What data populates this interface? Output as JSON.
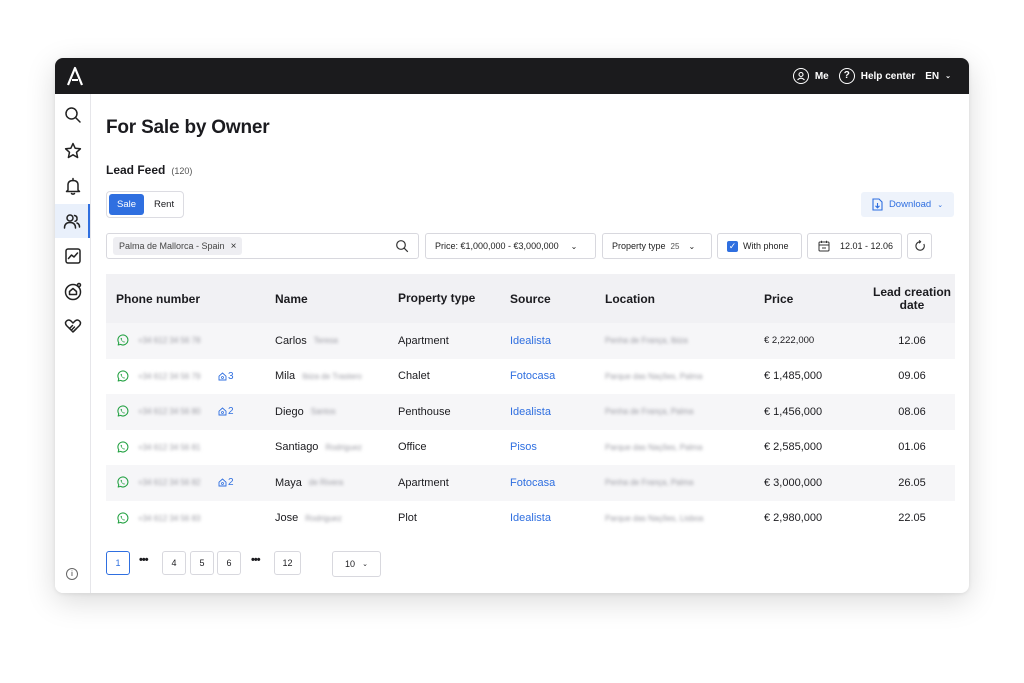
{
  "topbar": {
    "me_label": "Me",
    "help_label": "Help center",
    "lang_label": "EN",
    "help_icon_glyph": "?"
  },
  "sidebar": {
    "items": [
      "search",
      "favorites",
      "notifications",
      "leads",
      "analytics",
      "home-valuation",
      "partners"
    ],
    "active": "leads",
    "info_glyph": "i"
  },
  "page": {
    "title": "For Sale by Owner",
    "feed_title": "Lead Feed",
    "feed_count": "(120)"
  },
  "toggle": {
    "sale": "Sale",
    "rent": "Rent",
    "selected": "Sale"
  },
  "download_label": "Download",
  "filters": {
    "location_chip": "Palma de Mallorca - Spain",
    "price": "Price: €1,000,000 - €3,000,000",
    "property_type_label": "Property type",
    "property_type_count": "25",
    "with_phone": "With phone",
    "with_phone_checked": true,
    "date_range": "12.01 - 12.06"
  },
  "table": {
    "headers": {
      "phone": "Phone number",
      "name": "Name",
      "property_type": "Property type",
      "source": "Source",
      "location": "Location",
      "price": "Price",
      "date": "Lead creation date"
    },
    "rows": [
      {
        "phone": "+34 612 34 56 78",
        "dup": "",
        "first": "Carlos",
        "last": "Teresa",
        "type": "Apartment",
        "source": "Idealista",
        "location": "Penha de França, Ibiza",
        "price": "€ 2,222,000",
        "date": "12.06"
      },
      {
        "phone": "+34 612 34 56 79",
        "dup": "3",
        "first": "Mila",
        "last": "Ibiza de Trastero",
        "type": "Chalet",
        "source": "Fotocasa",
        "location": "Parque das Nações, Palma",
        "price": "€ 1,485,000",
        "date": "09.06"
      },
      {
        "phone": "+34 612 34 56 80",
        "dup": "2",
        "first": "Diego",
        "last": "Santos",
        "type": "Penthouse",
        "source": "Idealista",
        "location": "Penha de França, Palma",
        "price": "€ 1,456,000",
        "date": "08.06"
      },
      {
        "phone": "+34 612 34 56 81",
        "dup": "",
        "first": "Santiago",
        "last": "Rodriguez",
        "type": "Office",
        "source": "Pisos",
        "location": "Parque das Nações, Palma",
        "price": "€ 2,585,000",
        "date": "01.06"
      },
      {
        "phone": "+34 612 34 56 82",
        "dup": "2",
        "first": "Maya",
        "last": "de Rivera",
        "type": "Apartment",
        "source": "Fotocasa",
        "location": "Penha de França, Palma",
        "price": "€ 3,000,000",
        "date": "26.05"
      },
      {
        "phone": "+34 612 34 56 83",
        "dup": "",
        "first": "Jose",
        "last": "Rodriguez",
        "type": "Plot",
        "source": "Idealista",
        "location": "Parque das Nações, Lisboa",
        "price": "€ 2,980,000",
        "date": "22.05"
      }
    ]
  },
  "pagination": {
    "pages": [
      "1",
      "4",
      "5",
      "6",
      "12"
    ],
    "current": "1",
    "ellipsis": "•••",
    "per_page": "10"
  },
  "colors": {
    "accent": "#2f6fe0",
    "topbar": "#1b1b1d",
    "whatsapp": "#25a244"
  }
}
